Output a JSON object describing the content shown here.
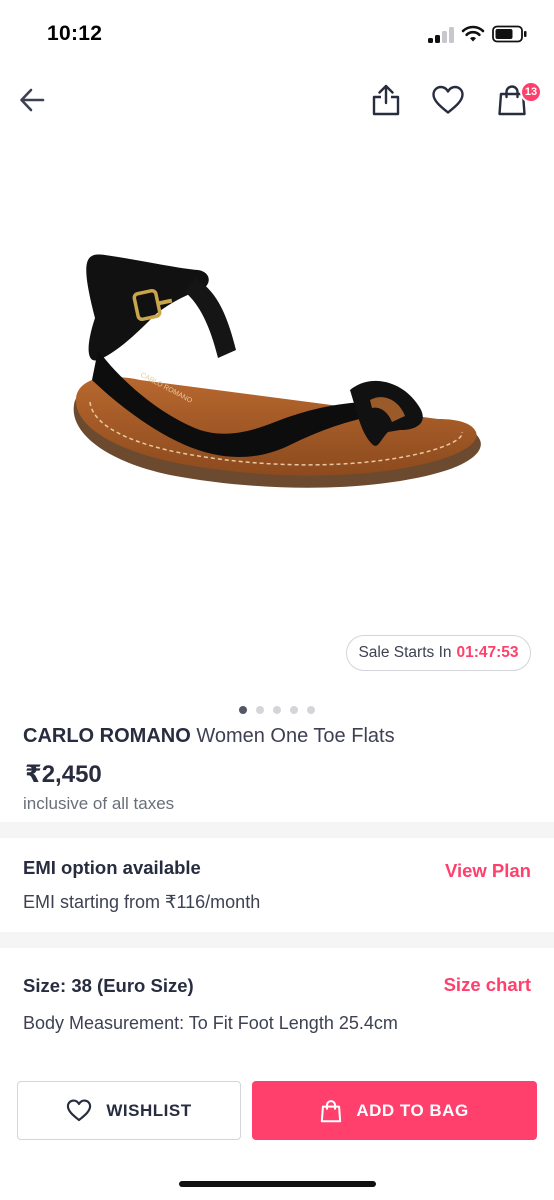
{
  "status_bar": {
    "time": "10:12",
    "icons": [
      "signal-icon",
      "wifi-icon",
      "battery-icon"
    ]
  },
  "nav": {
    "icons": [
      "back-arrow-icon",
      "share-icon",
      "heart-icon",
      "bag-icon"
    ],
    "bag_count": "13"
  },
  "gallery": {
    "image": "black suede one-toe flat sandal with tan footbed",
    "sale_label": "Sale Starts In",
    "sale_timer": "01:47:53",
    "slide_count": 5,
    "active_slide": 1
  },
  "product": {
    "brand": "CARLO ROMANO",
    "name": "Women One Toe Flats",
    "price": "₹2,450",
    "tax_note": "inclusive of all taxes"
  },
  "emi": {
    "title": "EMI option available",
    "subtitle": "EMI starting from ₹116/month",
    "link": "View Plan"
  },
  "size": {
    "title": "Size: 38 (Euro Size)",
    "subtitle": "Body Measurement: To Fit Foot Length 25.4cm",
    "link": "Size chart"
  },
  "footer": {
    "wishlist_label": "WISHLIST",
    "add_to_bag_label": "ADD TO BAG"
  },
  "colors": {
    "accent": "#ff3f6c",
    "text_primary": "#282c3f",
    "text_secondary": "#696e79",
    "divider": "#f5f5f6"
  }
}
